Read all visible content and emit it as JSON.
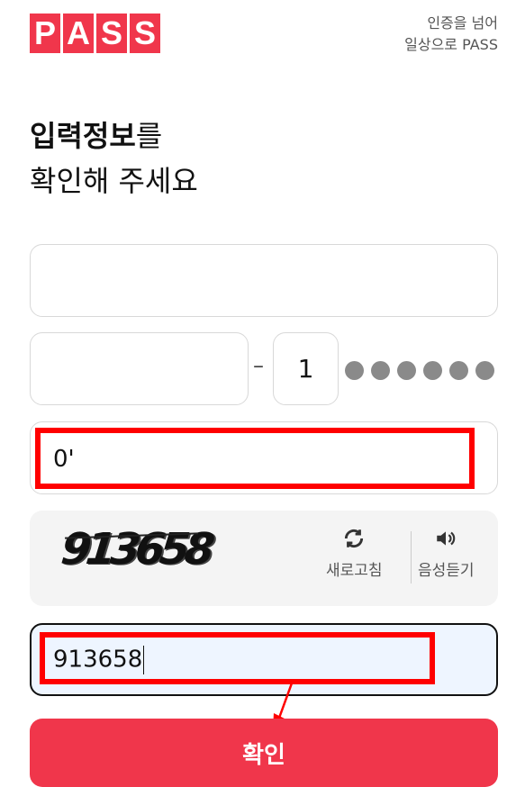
{
  "header": {
    "logo_letters": [
      "P",
      "A",
      "S",
      "S"
    ],
    "tagline_line1": "인증을 넘어",
    "tagline_line2": "일상으로 PASS",
    "brand_color": "#f0364b"
  },
  "headline": {
    "bold_part": "입력정보",
    "line1_suffix": "를",
    "line2": "확인해 주세요"
  },
  "form": {
    "name_value": "",
    "birth_value": "",
    "separator": "–",
    "gender_digit": "1",
    "masked_digits": 6,
    "phone_value": "0'",
    "captcha_text": "913658",
    "refresh_icon": "refresh-icon",
    "refresh_label": "새로고침",
    "audio_icon": "speaker-icon",
    "audio_label": "음성듣기",
    "captcha_input_value": "913658",
    "submit_label": "확인"
  },
  "annotations": {
    "highlight_color": "#ff0000"
  }
}
